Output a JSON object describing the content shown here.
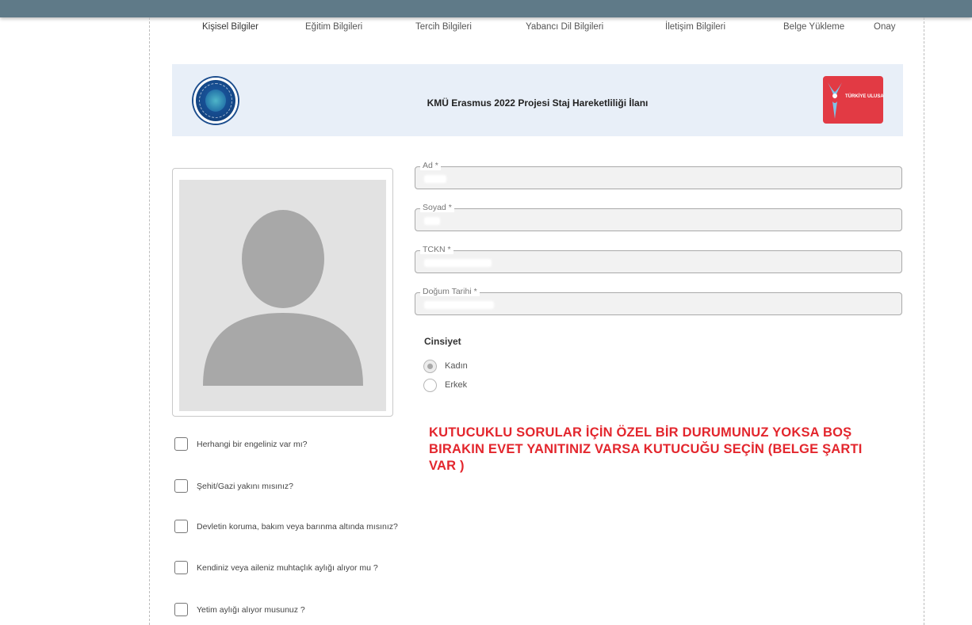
{
  "steps": [
    "Kişisel Bilgiler",
    "Eğitim Bilgileri",
    "Tercih Bilgileri",
    "Yabancı Dil Bilgileri",
    "İletişim Bilgileri",
    "Belge Yükleme",
    "Onay"
  ],
  "banner": {
    "title": "KMÜ Erasmus 2022 Projesi Staj Hareketliliği İlanı",
    "right_logo_text": "TÜRKİYE ULUSAL AJANSI"
  },
  "fields": [
    {
      "label": "Ad",
      "required": "*",
      "value": ""
    },
    {
      "label": "Soyad",
      "required": "*",
      "value": ""
    },
    {
      "label": "TCKN",
      "required": "*",
      "value": ""
    },
    {
      "label": "Doğum Tarihi",
      "required": "*",
      "value": ""
    }
  ],
  "gender": {
    "title": "Cinsiyet",
    "options": [
      {
        "label": "Kadın",
        "checked": true
      },
      {
        "label": "Erkek",
        "checked": false
      }
    ]
  },
  "note": "KUTUCUKLU SORULAR İÇİN ÖZEL BİR DURUMUNUZ YOKSA BOŞ BIRAKIN EVET YANITINIZ VARSA KUTUCUĞU SEÇİN (BELGE ŞARTI VAR )",
  "questions": [
    {
      "label": "Herhangi bir engeliniz var mı?",
      "checked": false
    },
    {
      "label": "Şehit/Gazi yakını mısınız?",
      "checked": false
    },
    {
      "label": "Devletin koruma, bakım veya barınma altında mısınız?",
      "checked": false
    },
    {
      "label": "Kendiniz veya aileniz muhtaçlık aylığı alıyor mu ?",
      "checked": false
    },
    {
      "label": "Yetim aylığı alıyor musunuz ?",
      "checked": false
    }
  ],
  "colors": {
    "topbar": "#5f7a88",
    "banner_bg": "#e8eff8",
    "note_red": "#e3262d",
    "field_bg": "#f2f2f2"
  }
}
